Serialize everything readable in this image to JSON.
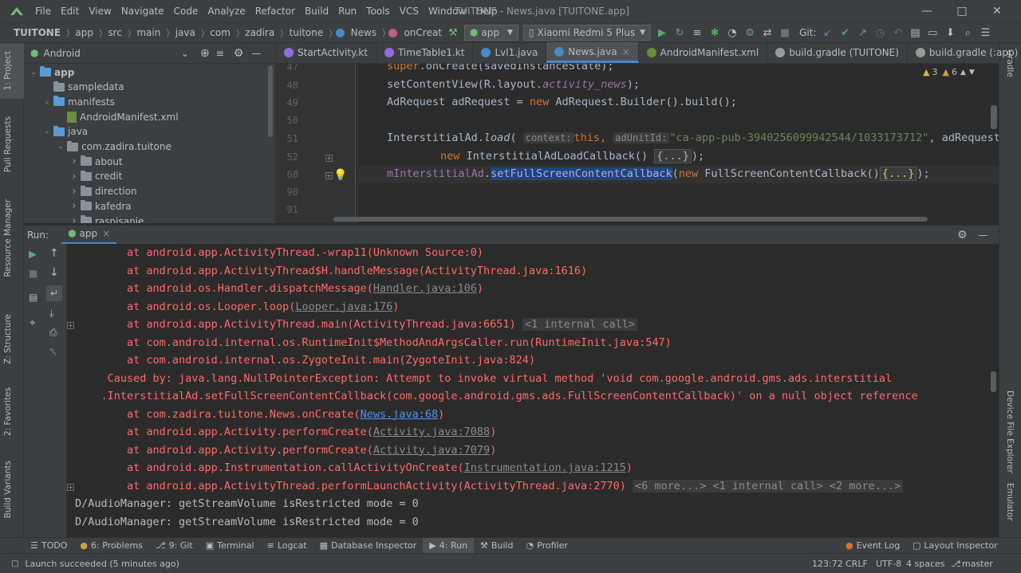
{
  "window": {
    "title": "TUITONE - News.java [TUITONE.app]",
    "menu": [
      "File",
      "Edit",
      "View",
      "Navigate",
      "Code",
      "Analyze",
      "Refactor",
      "Build",
      "Run",
      "Tools",
      "VCS",
      "Window",
      "Help"
    ]
  },
  "nav": {
    "crumbs": [
      "TUITONE",
      "app",
      "src",
      "main",
      "java",
      "com",
      "zadira",
      "tuitone",
      "News",
      "onCreat"
    ],
    "config": "app",
    "device": "Xiaomi Redmi 5 Plus",
    "git_label": "Git:"
  },
  "project": {
    "view": "Android",
    "tree": [
      {
        "label": "app",
        "depth": 0,
        "expanded": true,
        "icon": "folder-blue"
      },
      {
        "label": "sampledata",
        "depth": 1,
        "expanded": null,
        "icon": "folder"
      },
      {
        "label": "manifests",
        "depth": 1,
        "expanded": true,
        "icon": "folder-blue"
      },
      {
        "label": "AndroidManifest.xml",
        "depth": 2,
        "expanded": null,
        "icon": "xml"
      },
      {
        "label": "java",
        "depth": 1,
        "expanded": true,
        "icon": "folder-blue"
      },
      {
        "label": "com.zadira.tuitone",
        "depth": 2,
        "expanded": true,
        "icon": "package"
      },
      {
        "label": "about",
        "depth": 3,
        "expanded": false,
        "icon": "folder"
      },
      {
        "label": "credit",
        "depth": 3,
        "expanded": false,
        "icon": "folder"
      },
      {
        "label": "direction",
        "depth": 3,
        "expanded": false,
        "icon": "folder"
      },
      {
        "label": "kafedra",
        "depth": 3,
        "expanded": false,
        "icon": "folder"
      },
      {
        "label": "raspisanie",
        "depth": 3,
        "expanded": false,
        "icon": "folder"
      }
    ]
  },
  "editor": {
    "tabs": [
      {
        "label": "StartActivity.kt",
        "active": false,
        "icon_color": "#8f6de0"
      },
      {
        "label": "TimeTable1.kt",
        "active": false,
        "icon_color": "#8f6de0"
      },
      {
        "label": "Lvl1.java",
        "active": false,
        "icon_color": "#4a88c7"
      },
      {
        "label": "News.java",
        "active": true,
        "icon_color": "#4a88c7"
      },
      {
        "label": "AndroidManifest.xml",
        "active": false,
        "icon_color": "#6b8e3f"
      },
      {
        "label": "build.gradle (TUITONE)",
        "active": false,
        "icon_color": "#9a9a9a"
      },
      {
        "label": "build.gradle (:app)",
        "active": false,
        "icon_color": "#9a9a9a"
      }
    ],
    "line_numbers": [
      "47",
      "48",
      "49",
      "50",
      "51",
      "52",
      "68",
      "90",
      "91"
    ],
    "inspection": {
      "warnings": "3",
      "weak_warnings": "6"
    },
    "code": {
      "l47": "super.onCreate(savedInstanceState);",
      "l48_a": "setContentView(R.layout.",
      "l48_b": "activity_news",
      "l48_c": ");",
      "l49_a": "AdRequest adRequest = ",
      "l49_kw": "new",
      "l49_b": " AdRequest.Builder().build();",
      "l51_a": "InterstitialAd.",
      "l51_fn": "load",
      "l51_b": "(",
      "l51_hint1": "context:",
      "l51_this": "this,",
      "l51_hint2": "adUnitId:",
      "l51_str": "\"ca-app-pub-3940256099942544/1033173712\"",
      "l51_c": ", adRequest",
      "l52_kw": "new",
      "l52_a": " InterstitialAdLoadCallback() ",
      "l52_fold": "{...}",
      "l52_b": ");",
      "l68_field": "mInterstitialAd",
      "l68_dot": ".",
      "l68_sel": "setFullScreenContentCallback",
      "l68_a": "(",
      "l68_kw": "new",
      "l68_b": " FullScreenContentCallback()",
      "l68_fold": "{...}",
      "l68_c": ");"
    }
  },
  "run": {
    "label": "Run:",
    "tab": "app",
    "lines": [
      {
        "segs": [
          {
            "t": "        at android.app.ActivityThread.-wrap11(Unknown Source:0)",
            "c": "err"
          }
        ]
      },
      {
        "segs": [
          {
            "t": "        at android.app.ActivityThread$H.handleMessage(ActivityThread.java:1616)",
            "c": "err"
          }
        ]
      },
      {
        "segs": [
          {
            "t": "        at android.os.Handler.dispatchMessage(",
            "c": "err"
          },
          {
            "t": "Handler.java:106",
            "c": "dimlnk"
          },
          {
            "t": ")",
            "c": "err"
          }
        ]
      },
      {
        "segs": [
          {
            "t": "        at android.os.Looper.loop(",
            "c": "err"
          },
          {
            "t": "Looper.java:176",
            "c": "dimlnk"
          },
          {
            "t": ")",
            "c": "err"
          }
        ]
      },
      {
        "segs": [
          {
            "t": "        at android.app.ActivityThread.main(ActivityThread.java:6651) ",
            "c": "err"
          },
          {
            "t": "<1 internal call>",
            "c": "coll"
          }
        ],
        "fold": true
      },
      {
        "segs": [
          {
            "t": "        at com.android.internal.os.RuntimeInit$MethodAndArgsCaller.run(RuntimeInit.java:547)",
            "c": "err"
          }
        ]
      },
      {
        "segs": [
          {
            "t": "        at com.android.internal.os.ZygoteInit.main(ZygoteInit.java:824)",
            "c": "err"
          }
        ]
      },
      {
        "segs": [
          {
            "t": "     Caused by: java.lang.NullPointerException: Attempt to invoke virtual method 'void com.google.android.gms.ads.interstitial",
            "c": "err"
          }
        ]
      },
      {
        "segs": [
          {
            "t": "    .InterstitialAd.setFullScreenContentCallback(com.google.android.gms.ads.FullScreenContentCallback)' on a null object reference",
            "c": "err"
          }
        ]
      },
      {
        "segs": [
          {
            "t": "        at com.zadira.tuitone.News.onCreate(",
            "c": "err"
          },
          {
            "t": "News.java:68",
            "c": "lnk"
          },
          {
            "t": ")",
            "c": "err"
          }
        ]
      },
      {
        "segs": [
          {
            "t": "        at android.app.Activity.performCreate(",
            "c": "err"
          },
          {
            "t": "Activity.java:7088",
            "c": "dimlnk"
          },
          {
            "t": ")",
            "c": "err"
          }
        ]
      },
      {
        "segs": [
          {
            "t": "        at android.app.Activity.performCreate(",
            "c": "err"
          },
          {
            "t": "Activity.java:7079",
            "c": "dimlnk"
          },
          {
            "t": ")",
            "c": "err"
          }
        ]
      },
      {
        "segs": [
          {
            "t": "        at android.app.Instrumentation.callActivityOnCreate(",
            "c": "err"
          },
          {
            "t": "Instrumentation.java:1215",
            "c": "dimlnk"
          },
          {
            "t": ")",
            "c": "err"
          }
        ]
      },
      {
        "segs": [
          {
            "t": "        at android.app.ActivityThread.performLaunchActivity(ActivityThread.java:2770) ",
            "c": "err"
          },
          {
            "t": "<6 more...> <1 internal call> <2 more...>",
            "c": "coll"
          }
        ],
        "fold": true
      },
      {
        "segs": [
          {
            "t": "D/AudioManager: getStreamVolume isRestricted mode = 0",
            "c": "plain"
          }
        ]
      },
      {
        "segs": [
          {
            "t": "D/AudioManager: getStreamVolume isRestricted mode = 0",
            "c": "plain"
          }
        ]
      }
    ]
  },
  "left_strip": [
    "1: Project",
    "Pull Requests",
    "Resource Manager",
    "Z: Structure",
    "2: Favorites",
    "Build Variants"
  ],
  "right_strip": [
    "Gradle",
    "Device File Explorer",
    "Emulator"
  ],
  "toolwindows": {
    "items": [
      {
        "key": "todo",
        "label": "TODO"
      },
      {
        "key": "problems",
        "label": "6: Problems"
      },
      {
        "key": "git",
        "label": "9: Git"
      },
      {
        "key": "terminal",
        "label": "Terminal"
      },
      {
        "key": "logcat",
        "label": "Logcat"
      },
      {
        "key": "dbinspector",
        "label": "Database Inspector"
      },
      {
        "key": "run",
        "label": "4: Run"
      },
      {
        "key": "build",
        "label": "Build"
      },
      {
        "key": "profiler",
        "label": "Profiler"
      }
    ],
    "event_log": "Event Log",
    "layout_inspector": "Layout Inspector"
  },
  "status": {
    "message": "Launch succeeded (5 minutes ago)",
    "position": "123:72",
    "line_sep": "CRLF",
    "encoding": "UTF-8",
    "indent": "4 spaces",
    "branch": "master"
  },
  "colors": {
    "error": "#ff6b68",
    "keyword": "#cc7832",
    "string": "#6a8759",
    "link": "#5394ec",
    "accent": "#4a88c7"
  }
}
